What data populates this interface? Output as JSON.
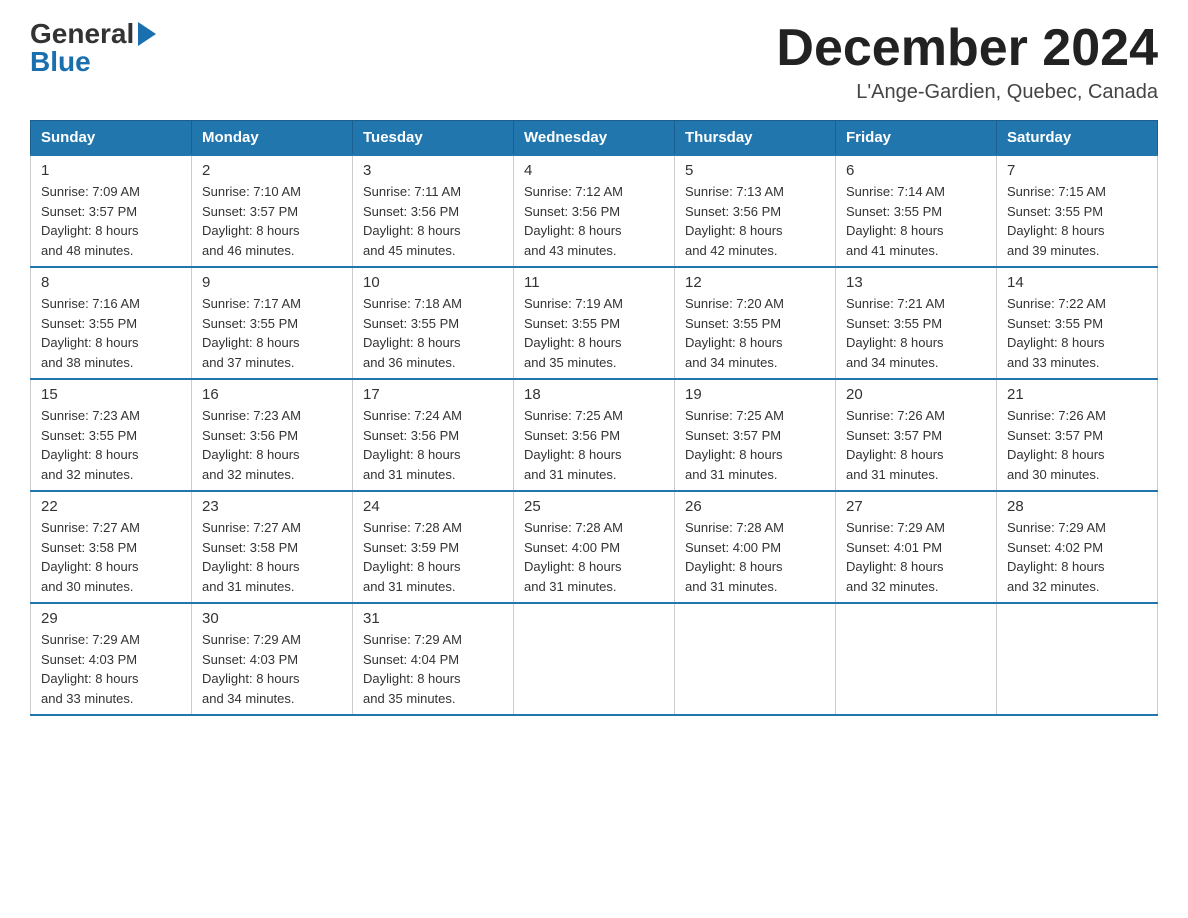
{
  "header": {
    "logo": {
      "general": "General",
      "blue": "Blue"
    },
    "title": "December 2024",
    "location": "L'Ange-Gardien, Quebec, Canada"
  },
  "days_of_week": [
    "Sunday",
    "Monday",
    "Tuesday",
    "Wednesday",
    "Thursday",
    "Friday",
    "Saturday"
  ],
  "weeks": [
    [
      {
        "day": "1",
        "sunrise": "7:09 AM",
        "sunset": "3:57 PM",
        "daylight": "8 hours and 48 minutes."
      },
      {
        "day": "2",
        "sunrise": "7:10 AM",
        "sunset": "3:57 PM",
        "daylight": "8 hours and 46 minutes."
      },
      {
        "day": "3",
        "sunrise": "7:11 AM",
        "sunset": "3:56 PM",
        "daylight": "8 hours and 45 minutes."
      },
      {
        "day": "4",
        "sunrise": "7:12 AM",
        "sunset": "3:56 PM",
        "daylight": "8 hours and 43 minutes."
      },
      {
        "day": "5",
        "sunrise": "7:13 AM",
        "sunset": "3:56 PM",
        "daylight": "8 hours and 42 minutes."
      },
      {
        "day": "6",
        "sunrise": "7:14 AM",
        "sunset": "3:55 PM",
        "daylight": "8 hours and 41 minutes."
      },
      {
        "day": "7",
        "sunrise": "7:15 AM",
        "sunset": "3:55 PM",
        "daylight": "8 hours and 39 minutes."
      }
    ],
    [
      {
        "day": "8",
        "sunrise": "7:16 AM",
        "sunset": "3:55 PM",
        "daylight": "8 hours and 38 minutes."
      },
      {
        "day": "9",
        "sunrise": "7:17 AM",
        "sunset": "3:55 PM",
        "daylight": "8 hours and 37 minutes."
      },
      {
        "day": "10",
        "sunrise": "7:18 AM",
        "sunset": "3:55 PM",
        "daylight": "8 hours and 36 minutes."
      },
      {
        "day": "11",
        "sunrise": "7:19 AM",
        "sunset": "3:55 PM",
        "daylight": "8 hours and 35 minutes."
      },
      {
        "day": "12",
        "sunrise": "7:20 AM",
        "sunset": "3:55 PM",
        "daylight": "8 hours and 34 minutes."
      },
      {
        "day": "13",
        "sunrise": "7:21 AM",
        "sunset": "3:55 PM",
        "daylight": "8 hours and 34 minutes."
      },
      {
        "day": "14",
        "sunrise": "7:22 AM",
        "sunset": "3:55 PM",
        "daylight": "8 hours and 33 minutes."
      }
    ],
    [
      {
        "day": "15",
        "sunrise": "7:23 AM",
        "sunset": "3:55 PM",
        "daylight": "8 hours and 32 minutes."
      },
      {
        "day": "16",
        "sunrise": "7:23 AM",
        "sunset": "3:56 PM",
        "daylight": "8 hours and 32 minutes."
      },
      {
        "day": "17",
        "sunrise": "7:24 AM",
        "sunset": "3:56 PM",
        "daylight": "8 hours and 31 minutes."
      },
      {
        "day": "18",
        "sunrise": "7:25 AM",
        "sunset": "3:56 PM",
        "daylight": "8 hours and 31 minutes."
      },
      {
        "day": "19",
        "sunrise": "7:25 AM",
        "sunset": "3:57 PM",
        "daylight": "8 hours and 31 minutes."
      },
      {
        "day": "20",
        "sunrise": "7:26 AM",
        "sunset": "3:57 PM",
        "daylight": "8 hours and 31 minutes."
      },
      {
        "day": "21",
        "sunrise": "7:26 AM",
        "sunset": "3:57 PM",
        "daylight": "8 hours and 30 minutes."
      }
    ],
    [
      {
        "day": "22",
        "sunrise": "7:27 AM",
        "sunset": "3:58 PM",
        "daylight": "8 hours and 30 minutes."
      },
      {
        "day": "23",
        "sunrise": "7:27 AM",
        "sunset": "3:58 PM",
        "daylight": "8 hours and 31 minutes."
      },
      {
        "day": "24",
        "sunrise": "7:28 AM",
        "sunset": "3:59 PM",
        "daylight": "8 hours and 31 minutes."
      },
      {
        "day": "25",
        "sunrise": "7:28 AM",
        "sunset": "4:00 PM",
        "daylight": "8 hours and 31 minutes."
      },
      {
        "day": "26",
        "sunrise": "7:28 AM",
        "sunset": "4:00 PM",
        "daylight": "8 hours and 31 minutes."
      },
      {
        "day": "27",
        "sunrise": "7:29 AM",
        "sunset": "4:01 PM",
        "daylight": "8 hours and 32 minutes."
      },
      {
        "day": "28",
        "sunrise": "7:29 AM",
        "sunset": "4:02 PM",
        "daylight": "8 hours and 32 minutes."
      }
    ],
    [
      {
        "day": "29",
        "sunrise": "7:29 AM",
        "sunset": "4:03 PM",
        "daylight": "8 hours and 33 minutes."
      },
      {
        "day": "30",
        "sunrise": "7:29 AM",
        "sunset": "4:03 PM",
        "daylight": "8 hours and 34 minutes."
      },
      {
        "day": "31",
        "sunrise": "7:29 AM",
        "sunset": "4:04 PM",
        "daylight": "8 hours and 35 minutes."
      },
      null,
      null,
      null,
      null
    ]
  ],
  "labels": {
    "sunrise": "Sunrise:",
    "sunset": "Sunset:",
    "daylight": "Daylight:"
  }
}
